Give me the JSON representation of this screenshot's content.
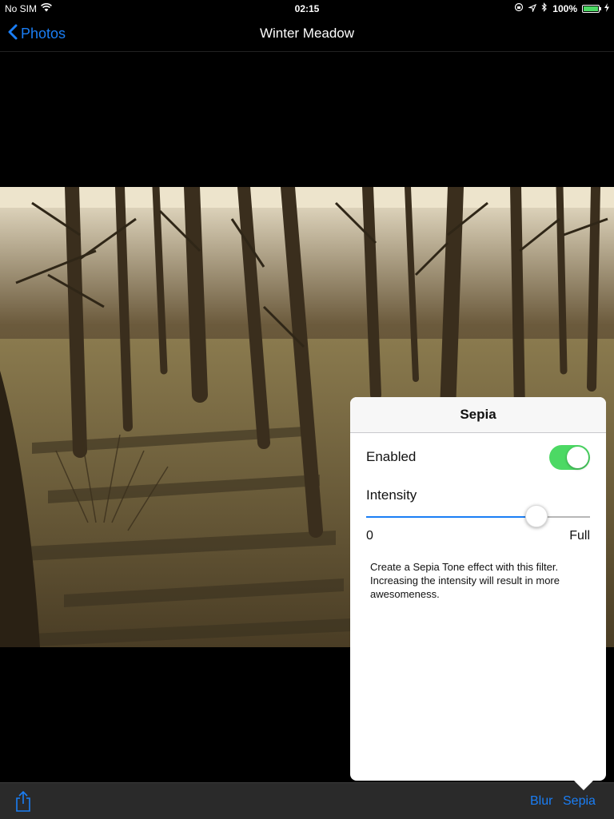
{
  "status_bar": {
    "carrier": "No SIM",
    "time": "02:15",
    "battery": "100%",
    "battery_level": 1.0
  },
  "nav": {
    "back_label": "Photos",
    "title": "Winter Meadow"
  },
  "popover": {
    "title": "Sepia",
    "enabled_label": "Enabled",
    "enabled": true,
    "intensity_label": "Intensity",
    "intensity_value": 0.76,
    "min_label": "0",
    "max_label": "Full",
    "description": "Create a Sepia Tone effect with this filter. Increasing the intensity will result in more awesomeness."
  },
  "toolbar": {
    "items": [
      {
        "label": "Blur"
      },
      {
        "label": "Sepia"
      }
    ]
  },
  "colors": {
    "tint": "#1a7ef5",
    "toggle_on": "#4cd964",
    "background": "#000000"
  },
  "icons": {
    "wifi": "wifi-icon",
    "location": "location-arrow-icon",
    "bluetooth": "bluetooth-icon",
    "share": "share-icon",
    "back": "chevron-left-icon"
  }
}
